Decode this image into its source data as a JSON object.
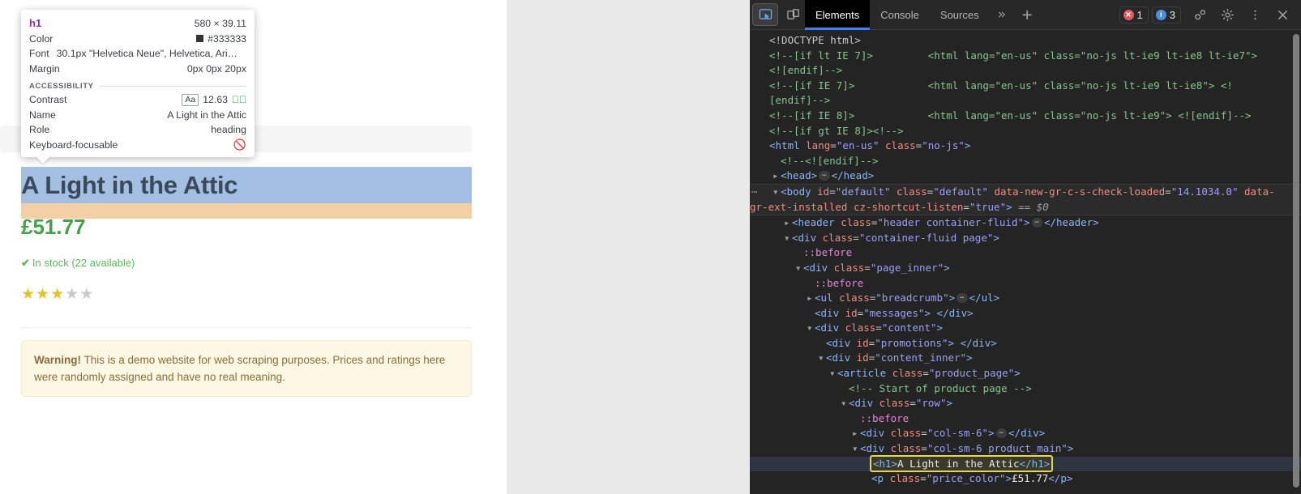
{
  "inspector_tooltip": {
    "tag": "h1",
    "dimensions": "580 × 39.11",
    "color_label": "Color",
    "color_value": "#333333",
    "color_swatch": "#333333",
    "font_label": "Font",
    "font_value": "30.1px \"Helvetica Neue\", Helvetica, Ari…",
    "margin_label": "Margin",
    "margin_value": "0px 0px 20px",
    "accessibility_heading": "ACCESSIBILITY",
    "contrast_label": "Contrast",
    "contrast_chip": "Aa",
    "contrast_value": "12.63",
    "contrast_status_icon": "check-circle-icon",
    "name_label": "Name",
    "name_value": "A Light in the Attic",
    "role_label": "Role",
    "role_value": "heading",
    "keyboard_label": "Keyboard-focusable",
    "keyboard_value_icon": "not-allowed-icon"
  },
  "page": {
    "product_title": "A Light in the Attic",
    "price": "£51.77",
    "stock_tick": "✔",
    "stock_text": "In stock (22 available)",
    "rating_filled": 3,
    "rating_total": 5,
    "star_glyph": "★",
    "warning_bold": "Warning!",
    "warning_text": " This is a demo website for web scraping purposes. Prices and ratings here were randomly assigned and have no real meaning.",
    "highlight_content_color": "#a3c0e3",
    "highlight_margin_color": "#f3cfa5",
    "price_color": "#46a24a",
    "title_color": "#3b4a5a"
  },
  "devtools": {
    "toolbar": {
      "inspect_icon": "inspect-element-icon",
      "device_icon": "device-toolbar-icon",
      "tabs": [
        {
          "label": "Elements",
          "selected": true
        },
        {
          "label": "Console",
          "selected": false
        },
        {
          "label": "Sources",
          "selected": false
        }
      ],
      "more_tabs_icon": "chevron-double-right-icon",
      "add_tab_icon": "plus-icon",
      "error_count": "1",
      "message_count": "3",
      "error_badge_color": "#e05c5c",
      "message_badge_color": "#4a90e2",
      "devices_icon": "user-flows-icon",
      "settings_icon": "gear-icon",
      "kebab_icon": "more-vertical-icon",
      "close_icon": "close-icon",
      "accent_color": "#3b82f6"
    },
    "dom_lines": [
      {
        "indent": 0,
        "parts": [
          {
            "t": "punc",
            "s": "<!DOCTYPE html>"
          }
        ]
      },
      {
        "indent": 0,
        "parts": [
          {
            "t": "cmt",
            "s": "<!--[if lt IE 7]>         <html lang=\"en-us\" class=\"no-js lt-ie9 lt-ie8 lt-ie7\">"
          }
        ]
      },
      {
        "indent": 0,
        "parts": [
          {
            "t": "cmt",
            "s": "<![endif]-->"
          }
        ]
      },
      {
        "indent": 0,
        "parts": [
          {
            "t": "cmt",
            "s": "<!--[if IE 7]>            <html lang=\"en-us\" class=\"no-js lt-ie9 lt-ie8\"> <!"
          }
        ]
      },
      {
        "indent": 0,
        "parts": [
          {
            "t": "cmt",
            "s": "[endif]-->"
          }
        ]
      },
      {
        "indent": 0,
        "parts": [
          {
            "t": "cmt",
            "s": "<!--[if IE 8]>            <html lang=\"en-us\" class=\"no-js lt-ie9\"> <![endif]-->"
          }
        ]
      },
      {
        "indent": 0,
        "parts": [
          {
            "t": "cmt",
            "s": "<!--[if gt IE 8]><!-->"
          }
        ]
      },
      {
        "indent": 0,
        "parts": [
          {
            "t": "tag",
            "s": "<html "
          },
          {
            "t": "attr",
            "s": "lang"
          },
          {
            "t": "punc",
            "s": "="
          },
          {
            "t": "val",
            "s": "\"en-us\""
          },
          {
            "t": "punc",
            "s": " "
          },
          {
            "t": "attr",
            "s": "class"
          },
          {
            "t": "punc",
            "s": "="
          },
          {
            "t": "val",
            "s": "\"no-js\""
          },
          {
            "t": "tag",
            "s": ">"
          }
        ]
      },
      {
        "indent": 1,
        "parts": [
          {
            "t": "cmt",
            "s": "<!--<![endif]-->"
          }
        ]
      },
      {
        "indent": 1,
        "collapsed": true,
        "parts": [
          {
            "t": "tag",
            "s": "<head>"
          },
          {
            "t": "ellip",
            "s": "…"
          },
          {
            "t": "tag",
            "s": "</head>"
          }
        ]
      },
      {
        "indent": 1,
        "expanded": true,
        "selected": "body",
        "dots": true,
        "parts": [
          {
            "t": "tag",
            "s": "<body "
          },
          {
            "t": "attr",
            "s": "id"
          },
          {
            "t": "punc",
            "s": "="
          },
          {
            "t": "val",
            "s": "\"default\""
          },
          {
            "t": "punc",
            "s": " "
          },
          {
            "t": "attr",
            "s": "class"
          },
          {
            "t": "punc",
            "s": "="
          },
          {
            "t": "val",
            "s": "\"default\""
          },
          {
            "t": "punc",
            "s": " "
          },
          {
            "t": "attr",
            "s": "data-new-gr-c-s-check-loaded"
          },
          {
            "t": "punc",
            "s": "="
          },
          {
            "t": "val",
            "s": "\"14.1034.0\""
          },
          {
            "t": "punc",
            "s": " "
          },
          {
            "t": "attr",
            "s": "data-gr-ext-installed"
          },
          {
            "t": "punc",
            "s": " "
          },
          {
            "t": "attr",
            "s": "cz-shortcut-listen"
          },
          {
            "t": "punc",
            "s": "="
          },
          {
            "t": "val",
            "s": "\"true\""
          },
          {
            "t": "tag",
            "s": ">"
          },
          {
            "t": "gray",
            "s": " == $0"
          }
        ]
      },
      {
        "indent": 2,
        "collapsed": true,
        "parts": [
          {
            "t": "tag",
            "s": "<header "
          },
          {
            "t": "attr",
            "s": "class"
          },
          {
            "t": "punc",
            "s": "="
          },
          {
            "t": "val",
            "s": "\"header container-fluid\""
          },
          {
            "t": "tag",
            "s": ">"
          },
          {
            "t": "ellip",
            "s": "…"
          },
          {
            "t": "tag",
            "s": "</header>"
          }
        ]
      },
      {
        "indent": 2,
        "expanded": true,
        "parts": [
          {
            "t": "tag",
            "s": "<div "
          },
          {
            "t": "attr",
            "s": "class"
          },
          {
            "t": "punc",
            "s": "="
          },
          {
            "t": "val",
            "s": "\"container-fluid page\""
          },
          {
            "t": "tag",
            "s": ">"
          }
        ]
      },
      {
        "indent": 3,
        "parts": [
          {
            "t": "pseudo",
            "s": "::before"
          }
        ]
      },
      {
        "indent": 3,
        "expanded": true,
        "parts": [
          {
            "t": "tag",
            "s": "<div "
          },
          {
            "t": "attr",
            "s": "class"
          },
          {
            "t": "punc",
            "s": "="
          },
          {
            "t": "val",
            "s": "\"page_inner\""
          },
          {
            "t": "tag",
            "s": ">"
          }
        ]
      },
      {
        "indent": 4,
        "parts": [
          {
            "t": "pseudo",
            "s": "::before"
          }
        ]
      },
      {
        "indent": 4,
        "collapsed": true,
        "parts": [
          {
            "t": "tag",
            "s": "<ul "
          },
          {
            "t": "attr",
            "s": "class"
          },
          {
            "t": "punc",
            "s": "="
          },
          {
            "t": "val",
            "s": "\"breadcrumb\""
          },
          {
            "t": "tag",
            "s": ">"
          },
          {
            "t": "ellip",
            "s": "…"
          },
          {
            "t": "tag",
            "s": "</ul>"
          }
        ]
      },
      {
        "indent": 4,
        "parts": [
          {
            "t": "tag",
            "s": "<div "
          },
          {
            "t": "attr",
            "s": "id"
          },
          {
            "t": "punc",
            "s": "="
          },
          {
            "t": "val",
            "s": "\"messages\""
          },
          {
            "t": "tag",
            "s": "> </div>"
          }
        ]
      },
      {
        "indent": 4,
        "expanded": true,
        "parts": [
          {
            "t": "tag",
            "s": "<div "
          },
          {
            "t": "attr",
            "s": "class"
          },
          {
            "t": "punc",
            "s": "="
          },
          {
            "t": "val",
            "s": "\"content\""
          },
          {
            "t": "tag",
            "s": ">"
          }
        ]
      },
      {
        "indent": 5,
        "parts": [
          {
            "t": "tag",
            "s": "<div "
          },
          {
            "t": "attr",
            "s": "id"
          },
          {
            "t": "punc",
            "s": "="
          },
          {
            "t": "val",
            "s": "\"promotions\""
          },
          {
            "t": "tag",
            "s": "> </div>"
          }
        ]
      },
      {
        "indent": 5,
        "expanded": true,
        "parts": [
          {
            "t": "tag",
            "s": "<div "
          },
          {
            "t": "attr",
            "s": "id"
          },
          {
            "t": "punc",
            "s": "="
          },
          {
            "t": "val",
            "s": "\"content_inner\""
          },
          {
            "t": "tag",
            "s": ">"
          }
        ]
      },
      {
        "indent": 6,
        "expanded": true,
        "parts": [
          {
            "t": "tag",
            "s": "<article "
          },
          {
            "t": "attr",
            "s": "class"
          },
          {
            "t": "punc",
            "s": "="
          },
          {
            "t": "val",
            "s": "\"product_page\""
          },
          {
            "t": "tag",
            "s": ">"
          }
        ]
      },
      {
        "indent": 7,
        "parts": [
          {
            "t": "cmt",
            "s": "<!-- Start of product page -->"
          }
        ]
      },
      {
        "indent": 7,
        "expanded": true,
        "parts": [
          {
            "t": "tag",
            "s": "<div "
          },
          {
            "t": "attr",
            "s": "class"
          },
          {
            "t": "punc",
            "s": "="
          },
          {
            "t": "val",
            "s": "\"row\""
          },
          {
            "t": "tag",
            "s": ">"
          }
        ]
      },
      {
        "indent": 8,
        "parts": [
          {
            "t": "pseudo",
            "s": "::before"
          }
        ]
      },
      {
        "indent": 8,
        "collapsed": true,
        "parts": [
          {
            "t": "tag",
            "s": "<div "
          },
          {
            "t": "attr",
            "s": "class"
          },
          {
            "t": "punc",
            "s": "="
          },
          {
            "t": "val",
            "s": "\"col-sm-6\""
          },
          {
            "t": "tag",
            "s": ">"
          },
          {
            "t": "ellip",
            "s": "…"
          },
          {
            "t": "tag",
            "s": "</div>"
          }
        ]
      },
      {
        "indent": 8,
        "expanded": true,
        "parts": [
          {
            "t": "tag",
            "s": "<div "
          },
          {
            "t": "attr",
            "s": "class"
          },
          {
            "t": "punc",
            "s": "="
          },
          {
            "t": "val",
            "s": "\"col-sm-6 product_main\""
          },
          {
            "t": "tag",
            "s": ">"
          }
        ]
      },
      {
        "indent": 9,
        "selected": "h1",
        "boxed": true,
        "parts": [
          {
            "t": "tag",
            "s": "<h1>"
          },
          {
            "t": "txt",
            "s": "A Light in the Attic"
          },
          {
            "t": "tag",
            "s": "</h1>"
          }
        ]
      },
      {
        "indent": 9,
        "parts": [
          {
            "t": "tag",
            "s": "<p "
          },
          {
            "t": "attr",
            "s": "class"
          },
          {
            "t": "punc",
            "s": "="
          },
          {
            "t": "val",
            "s": "\"price_color\""
          },
          {
            "t": "tag",
            "s": ">"
          },
          {
            "t": "txt",
            "s": "£51.77"
          },
          {
            "t": "tag",
            "s": "</p>"
          }
        ]
      }
    ]
  }
}
